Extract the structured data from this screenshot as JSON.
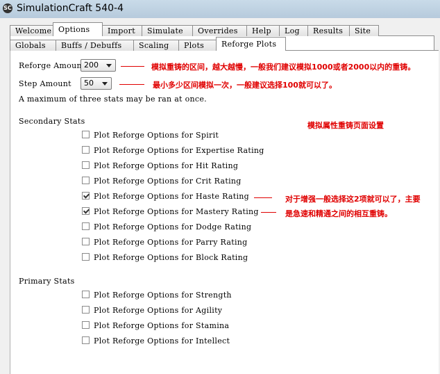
{
  "window": {
    "title": "SimulationCraft 540-4",
    "icon": "sc-logo-icon"
  },
  "main_tabs": [
    "Welcome",
    "Options",
    "Import",
    "Simulate",
    "Overrides",
    "Help",
    "Log",
    "Results",
    "Site"
  ],
  "sub_tabs": [
    "Globals",
    "Buffs / Debuffs",
    "Scaling",
    "Plots",
    "Reforge Plots"
  ],
  "form": {
    "reforge_amount_label": "Reforge Amount",
    "reforge_amount_value": "200",
    "step_amount_label": "Step Amount",
    "step_amount_value": "50",
    "max_note": "A maximum of three stats may be ran at once."
  },
  "secondary": {
    "header": "Secondary Stats",
    "items": [
      {
        "label": "Plot Reforge Options for Spirit",
        "checked": false
      },
      {
        "label": "Plot Reforge Options for Expertise Rating",
        "checked": false
      },
      {
        "label": "Plot Reforge Options for Hit Rating",
        "checked": false
      },
      {
        "label": "Plot Reforge Options for Crit Rating",
        "checked": false
      },
      {
        "label": "Plot Reforge Options for Haste Rating",
        "checked": true
      },
      {
        "label": "Plot Reforge Options for Mastery Rating",
        "checked": true
      },
      {
        "label": "Plot Reforge Options for Dodge Rating",
        "checked": false
      },
      {
        "label": "Plot Reforge Options for Parry Rating",
        "checked": false
      },
      {
        "label": "Plot Reforge Options for Block Rating",
        "checked": false
      }
    ]
  },
  "primary": {
    "header": "Primary Stats",
    "items": [
      {
        "label": "Plot Reforge Options for Strength",
        "checked": false
      },
      {
        "label": "Plot Reforge Options for Agility",
        "checked": false
      },
      {
        "label": "Plot Reforge Options for Stamina",
        "checked": false
      },
      {
        "label": "Plot Reforge Options for Intellect",
        "checked": false
      }
    ]
  },
  "annotations": {
    "reforge_amount": "模拟重铸的区间，越大越慢，一般我们建议模拟1000或者2000以内的重铸。",
    "step_amount": "最小多少区间模拟一次，一般建议选择100就可以了。",
    "page_setting": "模拟属性重铸页面设置",
    "enhance_line1": "对于增强一般选择这2项就可以了，主要",
    "enhance_line2": "是急速和精通之间的相互重铸。",
    "color": "#e00000"
  }
}
